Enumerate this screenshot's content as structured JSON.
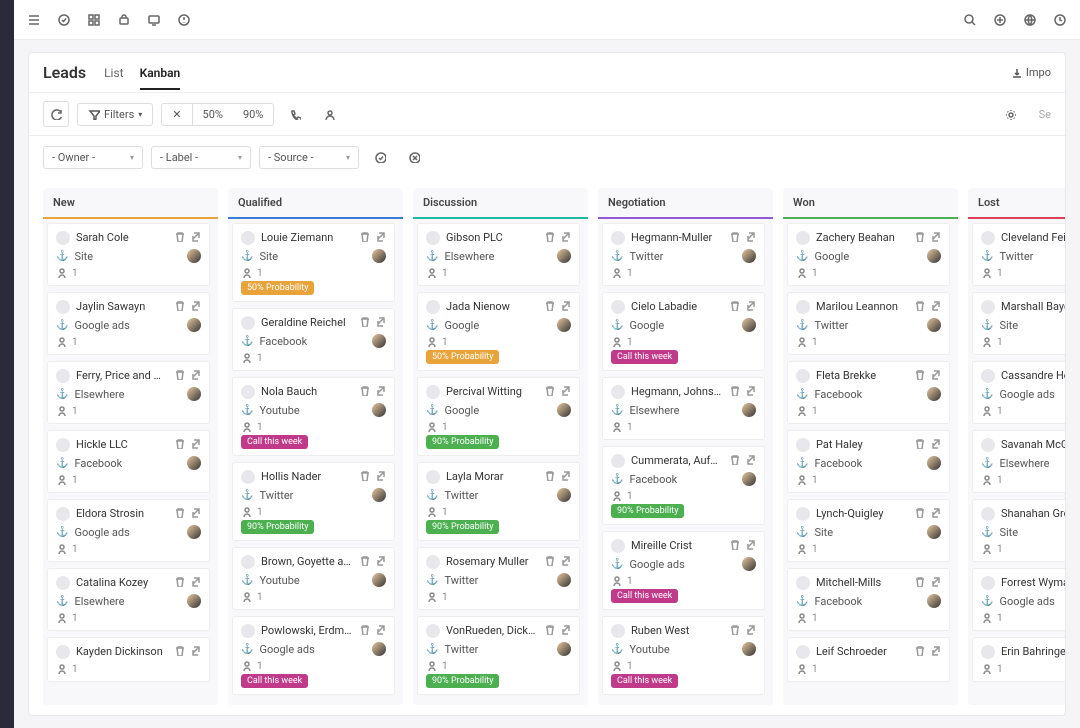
{
  "topIcons": [
    "menu",
    "check",
    "grid",
    "bag",
    "monitor",
    "alert"
  ],
  "topRight": [
    "search",
    "plus",
    "globe",
    "clock"
  ],
  "page": {
    "title": "Leads",
    "import": "Impo"
  },
  "tabs": [
    {
      "label": "List",
      "active": false
    },
    {
      "label": "Kanban",
      "active": true
    }
  ],
  "toolbar": {
    "filters": "Filters",
    "seg": [
      "50%",
      "90%"
    ]
  },
  "selects": [
    "- Owner -",
    "- Label -",
    "- Source -"
  ],
  "stageColors": {
    "New": "#e8a33a",
    "Qualified": "#3a7bd9",
    "Discussion": "#1fb8a0",
    "Negotiation": "#9059d9",
    "Won": "#4caf50",
    "Lost": "#d9415a"
  },
  "badges": {
    "call": "Call this week",
    "p50": "50% Probability",
    "p90": "90% Probability"
  },
  "columns": [
    {
      "name": "New",
      "cards": [
        {
          "name": "Sarah Cole",
          "src": "Site",
          "cnt": 1
        },
        {
          "name": "Jaylin Sawayn",
          "src": "Google ads",
          "cnt": 1
        },
        {
          "name": "Ferry, Price and Carter",
          "src": "Elsewhere",
          "cnt": 1
        },
        {
          "name": "Hickle LLC",
          "src": "Facebook",
          "cnt": 1
        },
        {
          "name": "Eldora Strosin",
          "src": "Google ads",
          "cnt": 1
        },
        {
          "name": "Catalina Kozey",
          "src": "Elsewhere",
          "cnt": 1
        },
        {
          "name": "Kayden Dickinson",
          "src": "",
          "cnt": 1
        }
      ]
    },
    {
      "name": "Qualified",
      "cards": [
        {
          "name": "Louie Ziemann",
          "src": "Site",
          "cnt": 1,
          "badge": "p50"
        },
        {
          "name": "Geraldine Reichel",
          "src": "Facebook",
          "cnt": 1
        },
        {
          "name": "Nola Bauch",
          "src": "Youtube",
          "cnt": 1,
          "badge": "call"
        },
        {
          "name": "Hollis Nader",
          "src": "Twitter",
          "cnt": 1,
          "badge": "p90"
        },
        {
          "name": "Brown, Goyette and Gusikowski",
          "src": "Youtube",
          "cnt": 1
        },
        {
          "name": "Powlowski, Erdman and Wilderman",
          "src": "Google ads",
          "cnt": 1,
          "badge": "call"
        }
      ]
    },
    {
      "name": "Discussion",
      "cards": [
        {
          "name": "Gibson PLC",
          "src": "Elsewhere",
          "cnt": 1
        },
        {
          "name": "Jada Nienow",
          "src": "Google",
          "cnt": 1,
          "badge": "p50"
        },
        {
          "name": "Percival Witting",
          "src": "Google",
          "cnt": 1,
          "badge": "p90"
        },
        {
          "name": "Layla Morar",
          "src": "Twitter",
          "cnt": 1,
          "badge": "p90"
        },
        {
          "name": "Rosemary Muller",
          "src": "Twitter",
          "cnt": 1
        },
        {
          "name": "VonRueden, Dickinson and Macejkovic",
          "src": "Twitter",
          "cnt": 1,
          "badge": "p90"
        }
      ]
    },
    {
      "name": "Negotiation",
      "cards": [
        {
          "name": "Hegmann-Muller",
          "src": "Twitter",
          "cnt": 1
        },
        {
          "name": "Cielo Labadie",
          "src": "Google",
          "cnt": 1,
          "badge": "call"
        },
        {
          "name": "Hegmann, Johns and Ankunding",
          "src": "Elsewhere",
          "cnt": 1
        },
        {
          "name": "Cummerata, Aufderhar and Bergnaum",
          "src": "Facebook",
          "cnt": 1,
          "badge": "p90"
        },
        {
          "name": "Mireille Crist",
          "src": "Google ads",
          "cnt": 1,
          "badge": "call"
        },
        {
          "name": "Ruben West",
          "src": "Youtube",
          "cnt": 1,
          "badge": "call"
        }
      ]
    },
    {
      "name": "Won",
      "cards": [
        {
          "name": "Zachery Beahan",
          "src": "Google",
          "cnt": 1
        },
        {
          "name": "Marilou Leannon",
          "src": "Twitter",
          "cnt": 1
        },
        {
          "name": "Fleta Brekke",
          "src": "Facebook",
          "cnt": 1
        },
        {
          "name": "Pat Haley",
          "src": "Facebook",
          "cnt": 1
        },
        {
          "name": "Lynch-Quigley",
          "src": "Site",
          "cnt": 1
        },
        {
          "name": "Mitchell-Mills",
          "src": "Facebook",
          "cnt": 1
        },
        {
          "name": "Leif Schroeder",
          "src": "",
          "cnt": 1
        }
      ]
    },
    {
      "name": "Lost",
      "cards": [
        {
          "name": "Cleveland Feil",
          "src": "Twitter",
          "cnt": 1
        },
        {
          "name": "Marshall Bayer",
          "src": "Site",
          "cnt": 1
        },
        {
          "name": "Cassandre Herman",
          "src": "Google ads",
          "cnt": 1
        },
        {
          "name": "Savanah McGlynn",
          "src": "Elsewhere",
          "cnt": 1
        },
        {
          "name": "Shanahan Group",
          "src": "Site",
          "cnt": 1
        },
        {
          "name": "Forrest Wyman",
          "src": "Google ads",
          "cnt": 1
        },
        {
          "name": "Erin Bahringer",
          "src": "",
          "cnt": 1
        }
      ]
    }
  ]
}
